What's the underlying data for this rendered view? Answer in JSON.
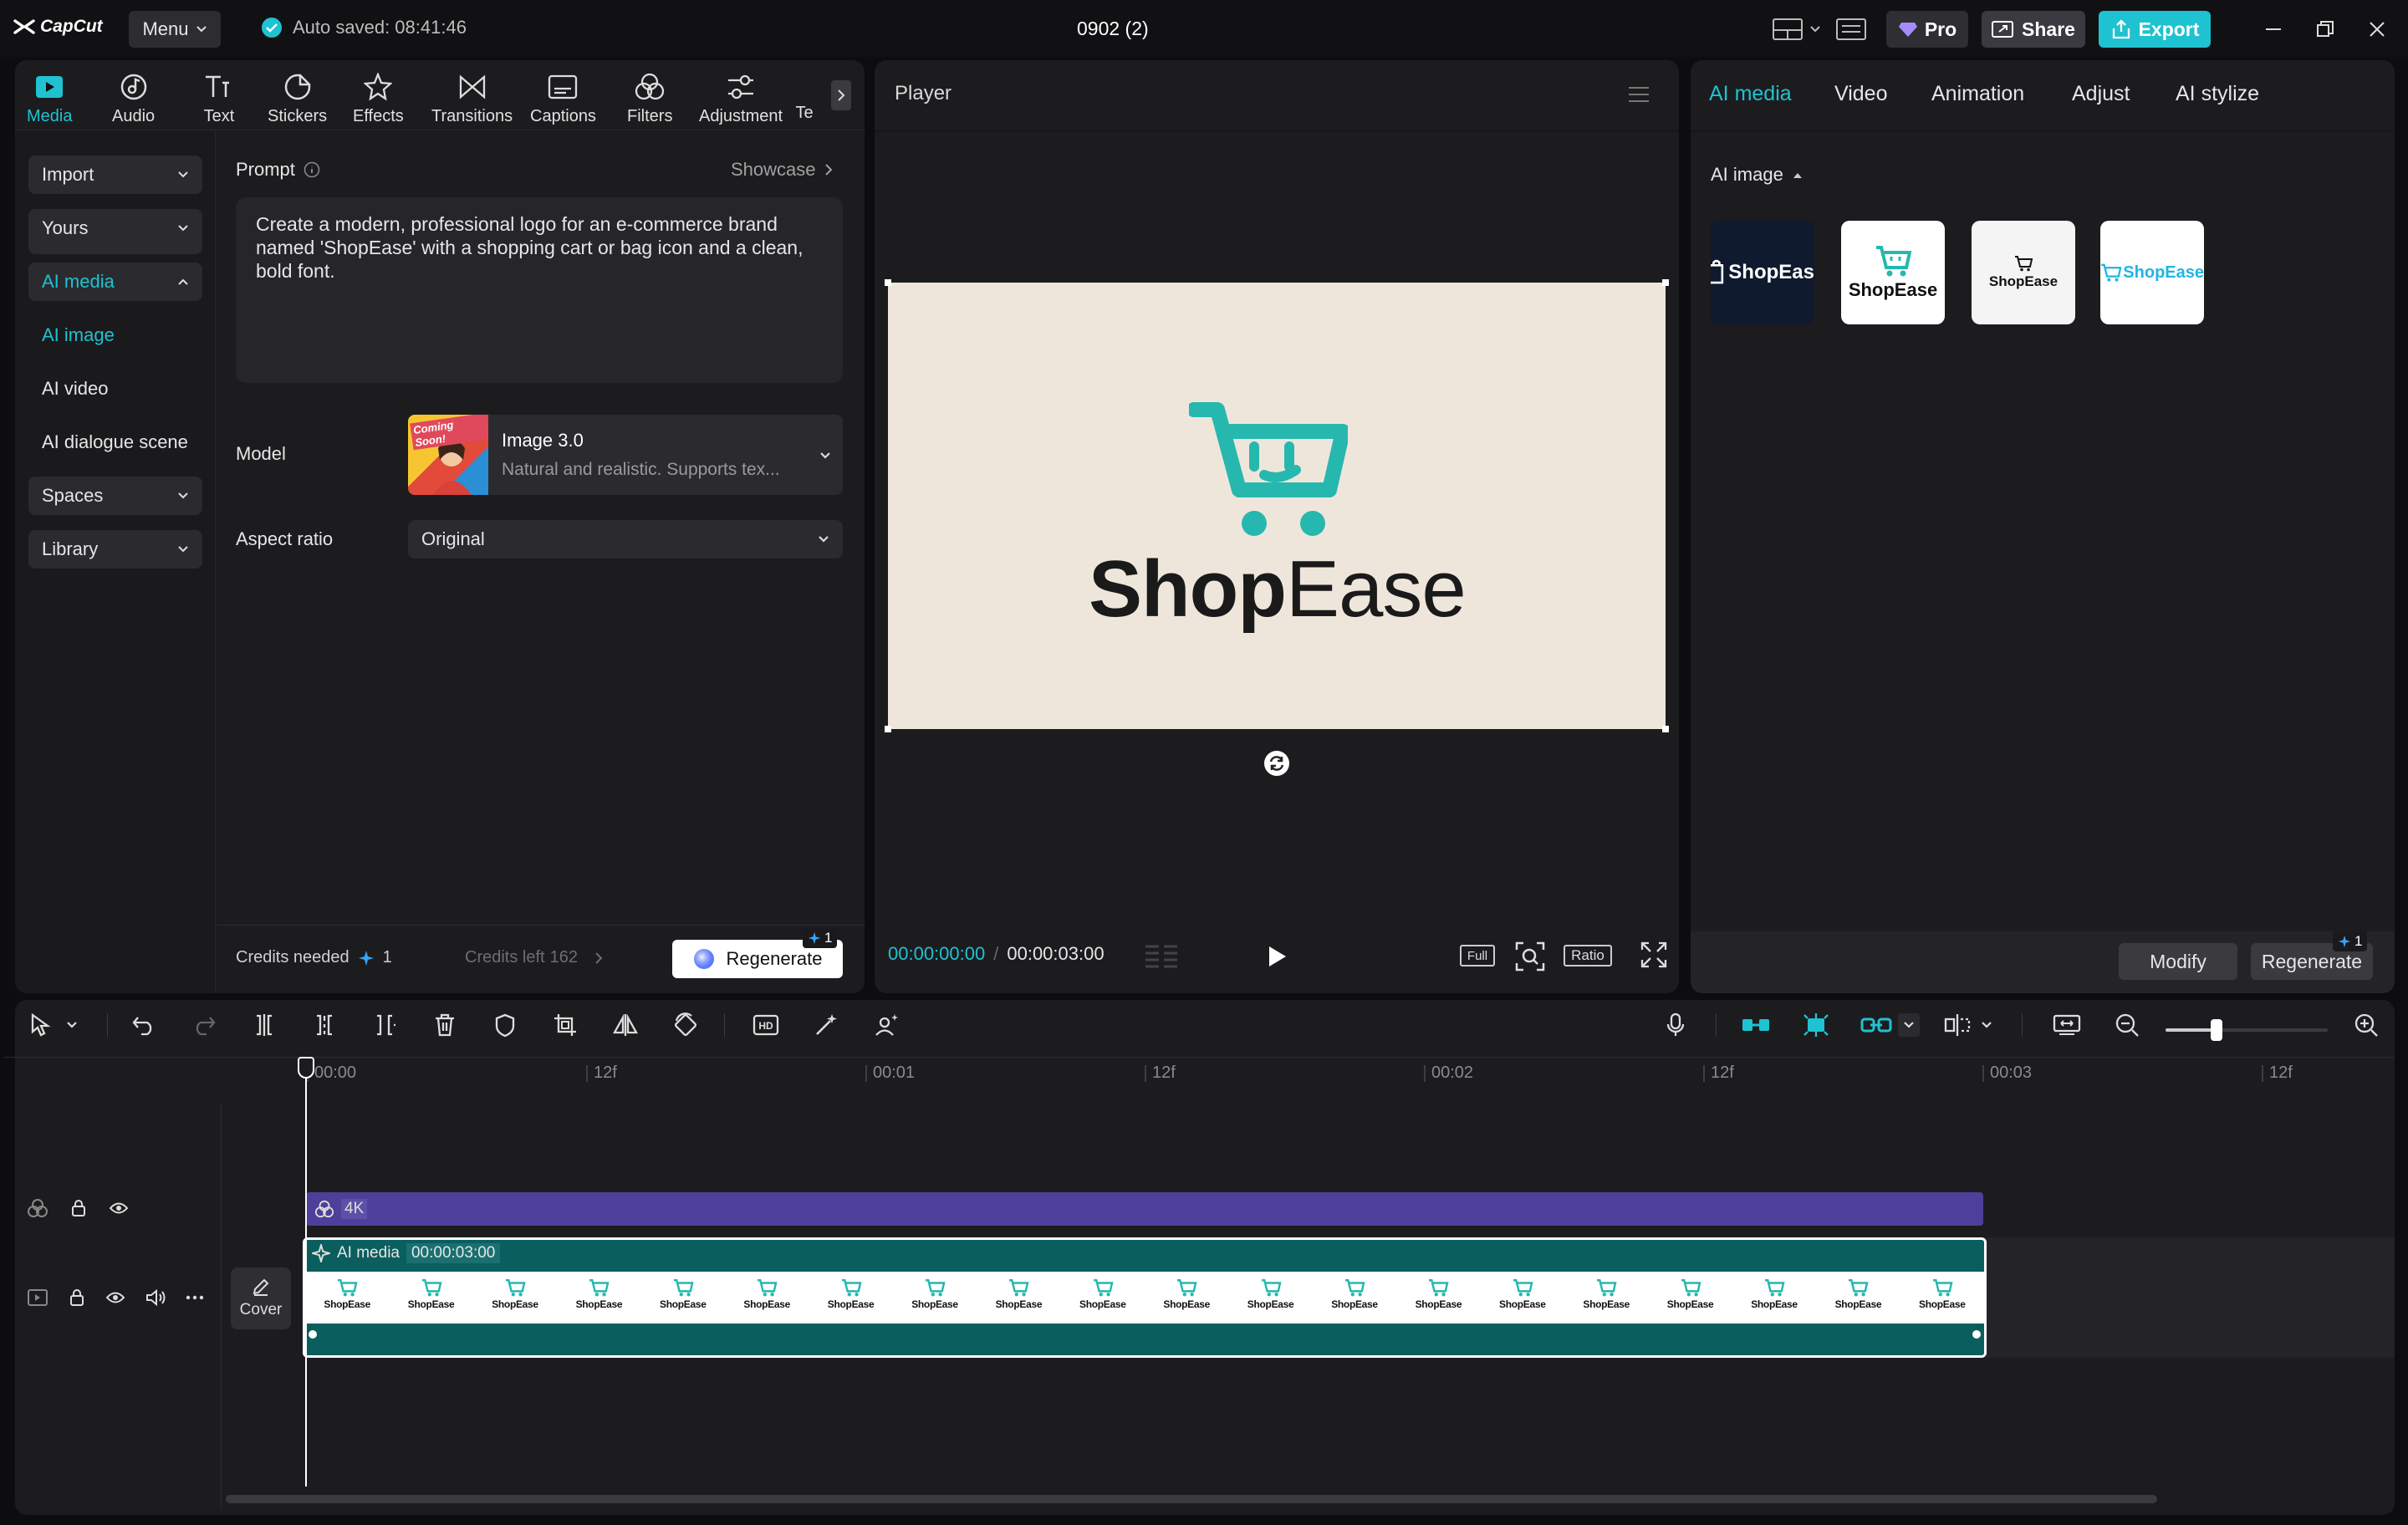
{
  "app": {
    "name": "CapCut",
    "menu_label": "Menu",
    "autosave": "Auto saved: 08:41:46",
    "project_title": "0902 (2)"
  },
  "titlebar": {
    "pro_label": "Pro",
    "share_label": "Share",
    "export_label": "Export",
    "accent": "#1fc2d0"
  },
  "toolbar": {
    "tabs": [
      {
        "label": "Media",
        "icon": "media-icon"
      },
      {
        "label": "Audio",
        "icon": "audio-icon"
      },
      {
        "label": "Text",
        "icon": "text-icon"
      },
      {
        "label": "Stickers",
        "icon": "stickers-icon"
      },
      {
        "label": "Effects",
        "icon": "effects-icon"
      },
      {
        "label": "Transitions",
        "icon": "transitions-icon"
      },
      {
        "label": "Captions",
        "icon": "captions-icon"
      },
      {
        "label": "Filters",
        "icon": "filters-icon"
      },
      {
        "label": "Adjustment",
        "icon": "adjustment-icon"
      },
      {
        "label": "Te",
        "icon": ""
      }
    ]
  },
  "sidebar": {
    "import": "Import",
    "yours": "Yours",
    "ai_media": "AI media",
    "ai_image": "AI image",
    "ai_video": "AI video",
    "ai_dialogue": "AI dialogue scene",
    "spaces": "Spaces",
    "library": "Library"
  },
  "generator": {
    "prompt_label": "Prompt",
    "showcase": "Showcase",
    "prompt_text": "Create a modern, professional logo for an e-commerce brand named 'ShopEase' with a shopping cart or bag icon and a clean, bold font.",
    "model_label": "Model",
    "model_name": "Image 3.0",
    "model_desc": "Natural and realistic. Supports tex...",
    "model_badge": "Coming Soon!",
    "aspect_label": "Aspect ratio",
    "aspect_value": "Original",
    "credits_needed_label": "Credits needed",
    "credits_needed": "1",
    "credits_left_label": "Credits left",
    "credits_left": "162",
    "regenerate": "Regenerate",
    "regenerate_cost": "1"
  },
  "player": {
    "title": "Player",
    "current_time": "00:00:00:00",
    "total_time": "00:00:03:00",
    "full_label": "Full",
    "ratio_label": "Ratio",
    "logo_text": "ShopEase",
    "logo_bg": "#efe6db",
    "logo_accent": "#26b8ae"
  },
  "right_panel": {
    "tabs": [
      "AI media",
      "Video",
      "Animation",
      "Adjust",
      "AI stylize"
    ],
    "section": "AI image",
    "thumbs": [
      "ShopEas",
      "ShopEase",
      "ShopEase",
      "ShopEase"
    ],
    "modify": "Modify",
    "regenerate": "Regenerate",
    "regenerate_cost": "1"
  },
  "timeline": {
    "ruler": [
      "00:00",
      "12f",
      "00:01",
      "12f",
      "00:02",
      "12f",
      "00:03",
      "12f"
    ],
    "effect_clip_label": "4K",
    "media_clip_label": "AI media",
    "media_clip_duration": "00:00:03:00",
    "cover_label": "Cover",
    "thumb_label": "ShopEase",
    "thumb_count": 20
  }
}
